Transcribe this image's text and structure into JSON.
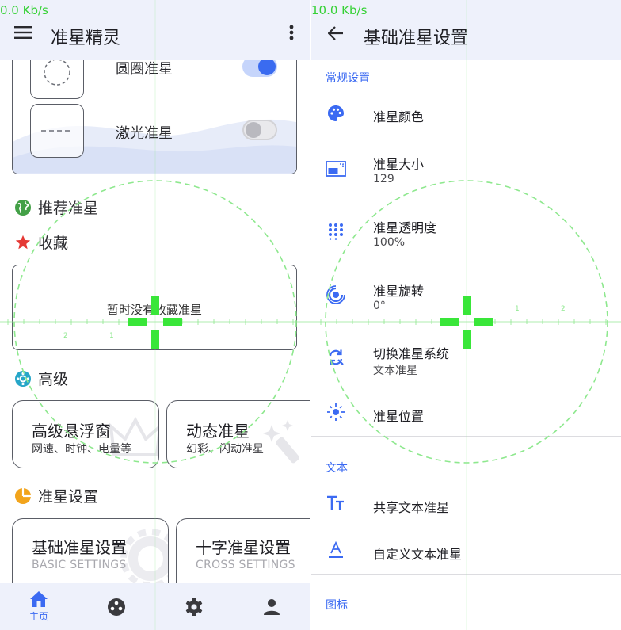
{
  "left": {
    "status": {
      "speed": "0.0 Kb/s"
    },
    "appbar": {
      "title": "准星精灵",
      "menu_icon": "menu-icon",
      "overflow_icon": "more-vert-icon"
    },
    "style_options": [
      {
        "label": "圆圈准星",
        "enabled": true
      },
      {
        "label": "激光准星",
        "enabled": false
      }
    ],
    "sections": {
      "recommended": "推荐准星",
      "favorites": "收藏",
      "advanced": "高级",
      "settings": "准星设置"
    },
    "favorites_empty": "暂时没有收藏准星",
    "advanced_tiles": [
      {
        "title": "高级悬浮窗",
        "subtitle": "网速、时钟、电量等"
      },
      {
        "title": "动态准星",
        "subtitle": "幻彩、闪动准星"
      }
    ],
    "settings_tiles": [
      {
        "title": "基础准星设置",
        "subtitle_en": "BASIC SETTINGS"
      },
      {
        "title": "十字准星设置",
        "subtitle_en": "CROSS SETTINGS"
      }
    ],
    "bottom_nav": [
      {
        "icon": "home-icon",
        "label": "主页",
        "active": true
      },
      {
        "icon": "palette-icon",
        "label": "",
        "active": false
      },
      {
        "icon": "gear-icon",
        "label": "",
        "active": false
      },
      {
        "icon": "person-icon",
        "label": "",
        "active": false
      }
    ]
  },
  "right": {
    "status": {
      "speed": "10.0 Kb/s"
    },
    "appbar": {
      "title": "基础准星设置",
      "back_icon": "arrow-back-icon"
    },
    "categories": {
      "general": "常规设置",
      "text": "文本",
      "icon": "图标"
    },
    "general_rows": [
      {
        "icon": "palette-icon",
        "title": "准星颜色",
        "value": ""
      },
      {
        "icon": "resize-icon",
        "title": "准星大小",
        "value": "129"
      },
      {
        "icon": "opacity-icon",
        "title": "准星透明度",
        "value": "100%"
      },
      {
        "icon": "rotate-icon",
        "title": "准星旋转",
        "value": "0°"
      },
      {
        "icon": "switch-icon",
        "title": "切换准星系统",
        "value": "文本准星"
      },
      {
        "icon": "position-icon",
        "title": "准星位置",
        "value": ""
      }
    ],
    "text_rows": [
      {
        "icon": "text-size-icon",
        "title": "共享文本准星"
      },
      {
        "icon": "text-format-icon",
        "title": "自定义文本准星"
      }
    ]
  },
  "overlay": {
    "crosshair_color": "#39e639",
    "circle_color": "#8ee88e",
    "accent": "#3b6af2",
    "ruler_numbers": [
      "2",
      "1",
      "1",
      "2"
    ]
  }
}
